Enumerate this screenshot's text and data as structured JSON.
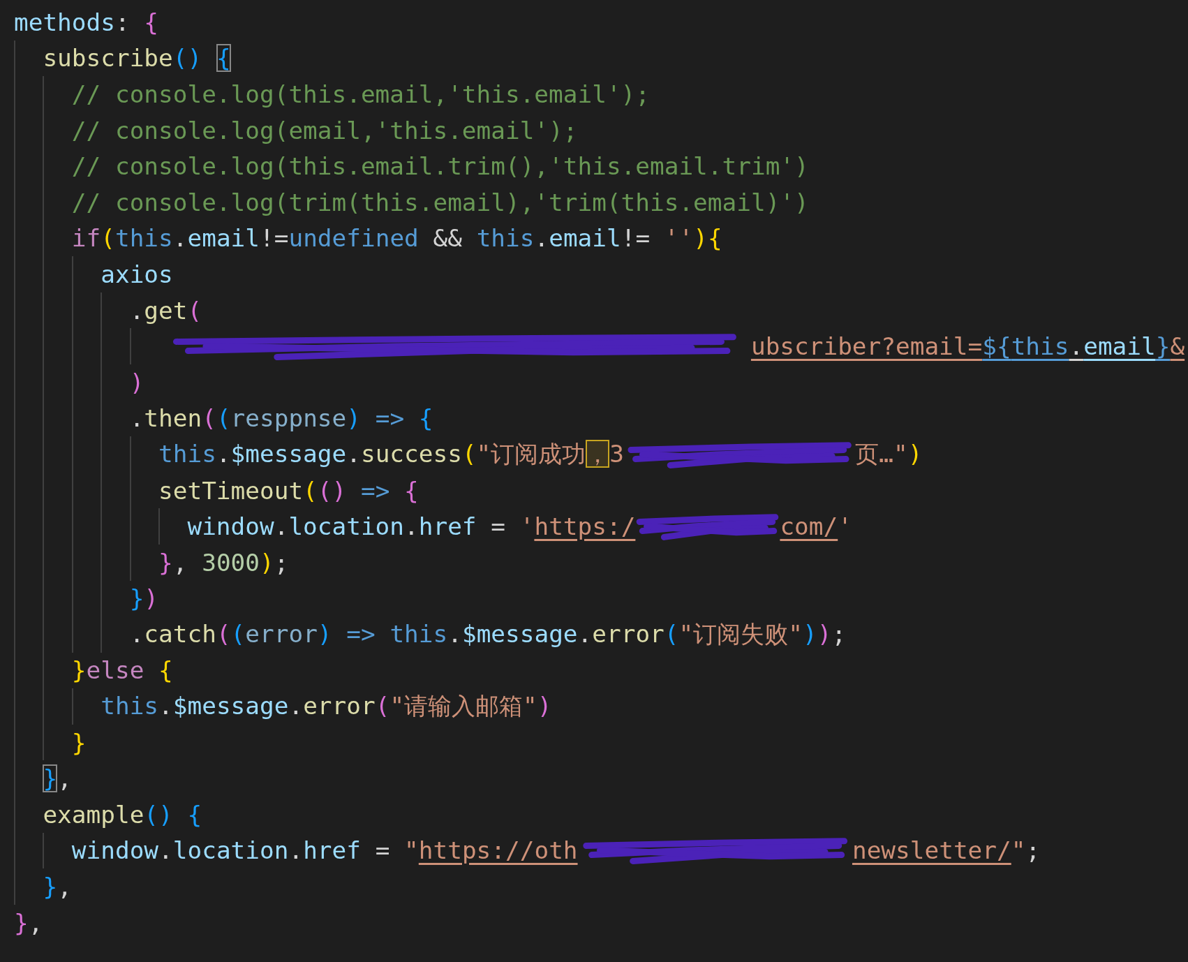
{
  "code": [
    {
      "tokens": [
        {
          "kind": "prop",
          "text": "methods"
        },
        {
          "kind": "punct",
          "text": ": "
        },
        {
          "kind": "brace1",
          "text": "{"
        }
      ],
      "children": [
        {
          "tokens": [
            {
              "kind": "fn",
              "text": "subscribe"
            },
            {
              "kind": "brace2",
              "text": "() "
            },
            {
              "kind": "brace2-match",
              "text": "{"
            }
          ],
          "children": [
            {
              "tokens": [
                {
                  "kind": "comment",
                  "text": "// console.log(this.email,'this.email');"
                }
              ]
            },
            {
              "tokens": [
                {
                  "kind": "comment",
                  "text": "// console.log(email,'this.email');"
                }
              ]
            },
            {
              "tokens": [
                {
                  "kind": "comment",
                  "text": "// console.log(this.email.trim(),'this.email.trim')"
                }
              ]
            },
            {
              "tokens": [
                {
                  "kind": "comment",
                  "text": "// console.log(trim(this.email),'trim(this.email)')"
                }
              ]
            },
            {
              "tokens": [
                {
                  "kind": "control",
                  "text": "if"
                },
                {
                  "kind": "brace3",
                  "text": "("
                },
                {
                  "kind": "keyword",
                  "text": "this"
                },
                {
                  "kind": "punct",
                  "text": "."
                },
                {
                  "kind": "prop",
                  "text": "email"
                },
                {
                  "kind": "punct",
                  "text": "!="
                },
                {
                  "kind": "keyword",
                  "text": "undefined"
                },
                {
                  "kind": "punct",
                  "text": " && "
                },
                {
                  "kind": "keyword",
                  "text": "this"
                },
                {
                  "kind": "punct",
                  "text": "."
                },
                {
                  "kind": "prop",
                  "text": "email"
                },
                {
                  "kind": "punct",
                  "text": "!= "
                },
                {
                  "kind": "string",
                  "text": "''"
                },
                {
                  "kind": "brace3",
                  "text": ")"
                },
                {
                  "kind": "brace3",
                  "text": "{"
                }
              ],
              "children": [
                {
                  "tokens": [
                    {
                      "kind": "prop",
                      "text": "axios"
                    }
                  ],
                  "children": [
                    {
                      "tokens": [
                        {
                          "kind": "punct",
                          "text": "."
                        },
                        {
                          "kind": "fn",
                          "text": "get"
                        },
                        {
                          "kind": "brace1",
                          "text": "("
                        }
                      ],
                      "children": [
                        {
                          "tokens": [
                            {
                              "kind": "redaction"
                            },
                            {
                              "kind": "link",
                              "text": "ubscriber?email="
                            },
                            {
                              "kind": "tmpl-brace",
                              "text": "${"
                            },
                            {
                              "kind": "tmpl-keyword",
                              "text": "this"
                            },
                            {
                              "kind": "tmpl-punct",
                              "text": "."
                            },
                            {
                              "kind": "tmpl-prop",
                              "text": "email"
                            },
                            {
                              "kind": "tmpl-brace",
                              "text": "}"
                            },
                            {
                              "kind": "link",
                              "text": "&"
                            }
                          ]
                        }
                      ]
                    },
                    {
                      "tokens": [
                        {
                          "kind": "brace1",
                          "text": ")"
                        }
                      ]
                    },
                    {
                      "tokens": [
                        {
                          "kind": "punct",
                          "text": "."
                        },
                        {
                          "kind": "fn",
                          "text": "then"
                        },
                        {
                          "kind": "brace1",
                          "text": "("
                        },
                        {
                          "kind": "brace2",
                          "text": "("
                        },
                        {
                          "kind": "param",
                          "text": "resppnse"
                        },
                        {
                          "kind": "brace2",
                          "text": ")"
                        },
                        {
                          "kind": "keyword",
                          "text": " => "
                        },
                        {
                          "kind": "brace2",
                          "text": "{"
                        }
                      ],
                      "children": [
                        {
                          "tokens": [
                            {
                              "kind": "keyword",
                              "text": "this"
                            },
                            {
                              "kind": "punct",
                              "text": "."
                            },
                            {
                              "kind": "prop",
                              "text": "$message"
                            },
                            {
                              "kind": "punct",
                              "text": "."
                            },
                            {
                              "kind": "fn",
                              "text": "success"
                            },
                            {
                              "kind": "brace3",
                              "text": "("
                            },
                            {
                              "kind": "string",
                              "text": "\"订阅成功"
                            },
                            {
                              "kind": "string-flag",
                              "text": "，"
                            },
                            {
                              "kind": "string",
                              "text": "3"
                            },
                            {
                              "kind": "redaction"
                            },
                            {
                              "kind": "string",
                              "text": "页…\""
                            },
                            {
                              "kind": "brace3",
                              "text": ")"
                            }
                          ]
                        },
                        {
                          "tokens": [
                            {
                              "kind": "fn",
                              "text": "setTimeout"
                            },
                            {
                              "kind": "brace3",
                              "text": "("
                            },
                            {
                              "kind": "brace1",
                              "text": "()"
                            },
                            {
                              "kind": "keyword",
                              "text": " => "
                            },
                            {
                              "kind": "brace1",
                              "text": "{"
                            }
                          ],
                          "children": [
                            {
                              "tokens": [
                                {
                                  "kind": "prop",
                                  "text": "window"
                                },
                                {
                                  "kind": "punct",
                                  "text": "."
                                },
                                {
                                  "kind": "prop",
                                  "text": "location"
                                },
                                {
                                  "kind": "punct",
                                  "text": "."
                                },
                                {
                                  "kind": "prop",
                                  "text": "href"
                                },
                                {
                                  "kind": "punct",
                                  "text": " = "
                                },
                                {
                                  "kind": "string",
                                  "text": "'"
                                },
                                {
                                  "kind": "link",
                                  "text": "https:/"
                                },
                                {
                                  "kind": "redaction"
                                },
                                {
                                  "kind": "link",
                                  "text": "com/"
                                },
                                {
                                  "kind": "string",
                                  "text": "'"
                                }
                              ]
                            }
                          ]
                        },
                        {
                          "tokens": [
                            {
                              "kind": "brace1",
                              "text": "}"
                            },
                            {
                              "kind": "punct",
                              "text": ", "
                            },
                            {
                              "kind": "number",
                              "text": "3000"
                            },
                            {
                              "kind": "brace3",
                              "text": ")"
                            },
                            {
                              "kind": "punct",
                              "text": ";"
                            }
                          ]
                        }
                      ]
                    },
                    {
                      "tokens": [
                        {
                          "kind": "brace2",
                          "text": "}"
                        },
                        {
                          "kind": "brace1",
                          "text": ")"
                        }
                      ]
                    },
                    {
                      "tokens": [
                        {
                          "kind": "punct",
                          "text": "."
                        },
                        {
                          "kind": "fn",
                          "text": "catch"
                        },
                        {
                          "kind": "brace1",
                          "text": "("
                        },
                        {
                          "kind": "brace2",
                          "text": "("
                        },
                        {
                          "kind": "param",
                          "text": "error"
                        },
                        {
                          "kind": "brace2",
                          "text": ")"
                        },
                        {
                          "kind": "keyword",
                          "text": " => "
                        },
                        {
                          "kind": "keyword",
                          "text": "this"
                        },
                        {
                          "kind": "punct",
                          "text": "."
                        },
                        {
                          "kind": "prop",
                          "text": "$message"
                        },
                        {
                          "kind": "punct",
                          "text": "."
                        },
                        {
                          "kind": "fn",
                          "text": "error"
                        },
                        {
                          "kind": "brace2",
                          "text": "("
                        },
                        {
                          "kind": "string",
                          "text": "\"订阅失败\""
                        },
                        {
                          "kind": "brace2",
                          "text": ")"
                        },
                        {
                          "kind": "brace1",
                          "text": ")"
                        },
                        {
                          "kind": "punct",
                          "text": ";"
                        }
                      ]
                    }
                  ]
                }
              ]
            },
            {
              "tokens": [
                {
                  "kind": "brace3",
                  "text": "}"
                },
                {
                  "kind": "control",
                  "text": "else "
                },
                {
                  "kind": "brace3",
                  "text": "{"
                }
              ],
              "children": [
                {
                  "tokens": [
                    {
                      "kind": "keyword",
                      "text": "this"
                    },
                    {
                      "kind": "punct",
                      "text": "."
                    },
                    {
                      "kind": "prop",
                      "text": "$message"
                    },
                    {
                      "kind": "punct",
                      "text": "."
                    },
                    {
                      "kind": "fn",
                      "text": "error"
                    },
                    {
                      "kind": "brace1",
                      "text": "("
                    },
                    {
                      "kind": "string",
                      "text": "\"请输入邮箱\""
                    },
                    {
                      "kind": "brace1",
                      "text": ")"
                    }
                  ]
                }
              ]
            },
            {
              "tokens": [
                {
                  "kind": "brace3",
                  "text": "}"
                }
              ]
            }
          ]
        },
        {
          "tokens": [
            {
              "kind": "brace2-match",
              "text": "}"
            },
            {
              "kind": "punct",
              "text": ","
            }
          ]
        },
        {
          "tokens": [
            {
              "kind": "fn",
              "text": "example"
            },
            {
              "kind": "brace2",
              "text": "() "
            },
            {
              "kind": "brace2",
              "text": "{"
            }
          ],
          "children": [
            {
              "tokens": [
                {
                  "kind": "prop",
                  "text": "window"
                },
                {
                  "kind": "punct",
                  "text": "."
                },
                {
                  "kind": "prop",
                  "text": "location"
                },
                {
                  "kind": "punct",
                  "text": "."
                },
                {
                  "kind": "prop",
                  "text": "href"
                },
                {
                  "kind": "punct",
                  "text": " = "
                },
                {
                  "kind": "string",
                  "text": "\""
                },
                {
                  "kind": "link",
                  "text": "https://oth"
                },
                {
                  "kind": "redaction"
                },
                {
                  "kind": "link",
                  "text": "newsletter/"
                },
                {
                  "kind": "string",
                  "text": "\""
                },
                {
                  "kind": "punct",
                  "text": ";"
                }
              ]
            }
          ]
        },
        {
          "tokens": [
            {
              "kind": "brace2",
              "text": "}"
            },
            {
              "kind": "punct",
              "text": ","
            }
          ]
        }
      ]
    },
    {
      "tokens": [
        {
          "kind": "brace1",
          "text": "}"
        },
        {
          "kind": "punct",
          "text": ","
        }
      ]
    }
  ]
}
